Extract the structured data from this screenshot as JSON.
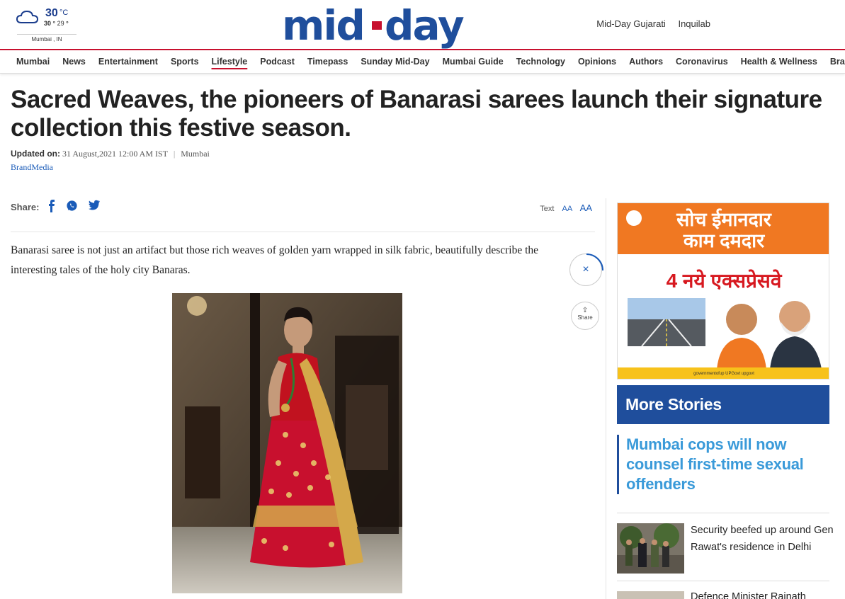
{
  "weather": {
    "temp": "30",
    "unit": "°C",
    "high": "30",
    "low": "29",
    "location": "Mumbai , IN",
    "icon": "cloud-icon"
  },
  "logo": {
    "text": "mid-day",
    "color": "#1f4e9c"
  },
  "editions": [
    "Mid-Day Gujarati",
    "Inquilab"
  ],
  "nav": {
    "items": [
      "Mumbai",
      "News",
      "Entertainment",
      "Sports",
      "Lifestyle",
      "Podcast",
      "Timepass",
      "Sunday Mid-Day",
      "Mumbai Guide",
      "Technology",
      "Opinions",
      "Authors",
      "Coronavirus",
      "Health & Wellness",
      "Brand Media"
    ],
    "active": "Lifestyle",
    "accent": "#c8102e"
  },
  "article": {
    "headline": "Sacred Weaves, the pioneers of Banarasi sarees launch their signature collection this festive season.",
    "updated_label": "Updated on:",
    "updated_value": "31 August,2021 12:00 AM IST",
    "location": "Mumbai",
    "category": "BrandMedia",
    "share_label": "Share:",
    "text_label": "Text",
    "text_small": "AA",
    "text_large": "AA",
    "lede": "Banarasi saree is not just an artifact but those rich weaves of golden yarn wrapped in silk fabric, beautifully describe the interesting tales of the holy city Banaras."
  },
  "floating": {
    "close": "×",
    "share": "Share"
  },
  "sidebar": {
    "ad": {
      "line1": "सोच ईमानदार",
      "line2": "काम दमदार",
      "line3": "4 नये एक्सप्रेसवे",
      "footer": "governmentofup   UPGovt   upgovt"
    },
    "more_stories": "More Stories",
    "stories": [
      "Mumbai cops will now counsel first-time sexual offenders",
      "Security beefed up around Gen Rawat's residence in Delhi",
      "Defence Minister Rajnath"
    ]
  }
}
